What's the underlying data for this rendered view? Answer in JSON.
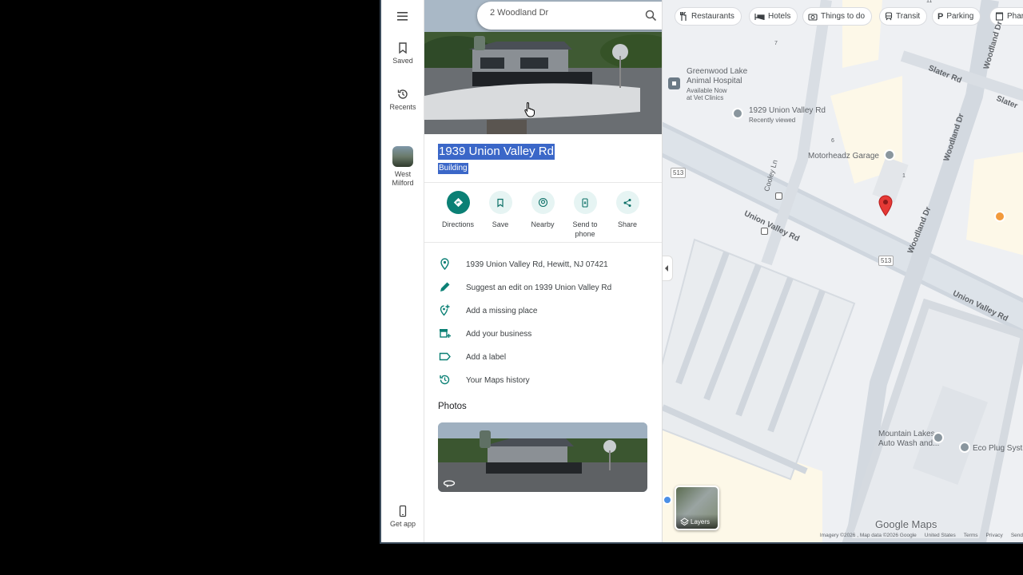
{
  "rail": {
    "saved": "Saved",
    "recents": "Recents",
    "west_line1": "West",
    "west_line2": "Milford",
    "get_app": "Get app"
  },
  "search": {
    "value": "2 Woodland Dr"
  },
  "place": {
    "title": "1939 Union Valley Rd",
    "type": "Building"
  },
  "actions": [
    {
      "label": "Directions",
      "icon": "directions-icon"
    },
    {
      "label": "Save",
      "icon": "bookmark-icon"
    },
    {
      "label": "Nearby",
      "icon": "nearby-icon"
    },
    {
      "label_1": "Send to",
      "label_2": "phone",
      "icon": "phone-icon"
    },
    {
      "label": "Share",
      "icon": "share-icon"
    }
  ],
  "info_rows": [
    {
      "text": "1939 Union Valley Rd, Hewitt, NJ 07421",
      "icon": "location-pin-icon"
    },
    {
      "text": "Suggest an edit on 1939 Union Valley Rd",
      "icon": "pencil-icon"
    },
    {
      "text": "Add a missing place",
      "icon": "add-place-icon"
    },
    {
      "text": "Add your business",
      "icon": "store-icon"
    },
    {
      "text": "Add a label",
      "icon": "label-icon"
    },
    {
      "text": "Your Maps history",
      "icon": "history-icon"
    }
  ],
  "photos_heading": "Photos",
  "chips": [
    {
      "label": "Restaurants",
      "icon": "fork-knife-icon"
    },
    {
      "label": "Hotels",
      "icon": "bed-icon"
    },
    {
      "label": "Things to do",
      "icon": "camera-icon"
    },
    {
      "label": "Transit",
      "icon": "train-icon"
    },
    {
      "label": "Parking",
      "icon": "parking-icon"
    },
    {
      "label": "Phar",
      "icon": "pharmacy-icon"
    }
  ],
  "map": {
    "poi_greenwood_1": "Greenwood Lake",
    "poi_greenwood_2": "Animal Hospital",
    "poi_greenwood_3": "Available Now",
    "poi_greenwood_4": "at Vet Clinics",
    "poi_1929": "1929 Union Valley Rd",
    "poi_1929_sub": "Recently viewed",
    "poi_motorheadz": "Motorheadz Garage",
    "poi_mountain_1": "Mountain Lakes",
    "poi_mountain_2": "Auto Wash and...",
    "poi_ecoplug": "Eco Plug Syst",
    "road_union_1": "Union Valley Rd",
    "road_union_2": "Union Valley Rd",
    "road_slater_1": "Slater Rd",
    "road_slater_2": "Slater",
    "road_woodland_1": "Woodland Dr",
    "road_woodland_2": "Woodland Dr",
    "road_woodland_3": "Woodland Dr",
    "road_cooley": "Cooley Ln",
    "shield_1": "513",
    "shield_2": "513",
    "num_7": "7",
    "num_6": "6",
    "num_11": "11",
    "num_1": "1",
    "layers": "Layers",
    "google_maps": "Google Maps"
  },
  "footer": {
    "imagery": "Imagery ©2026 , Map data ©2026 Google",
    "country": "United States",
    "terms": "Terms",
    "privacy": "Privacy",
    "send": "Send"
  }
}
